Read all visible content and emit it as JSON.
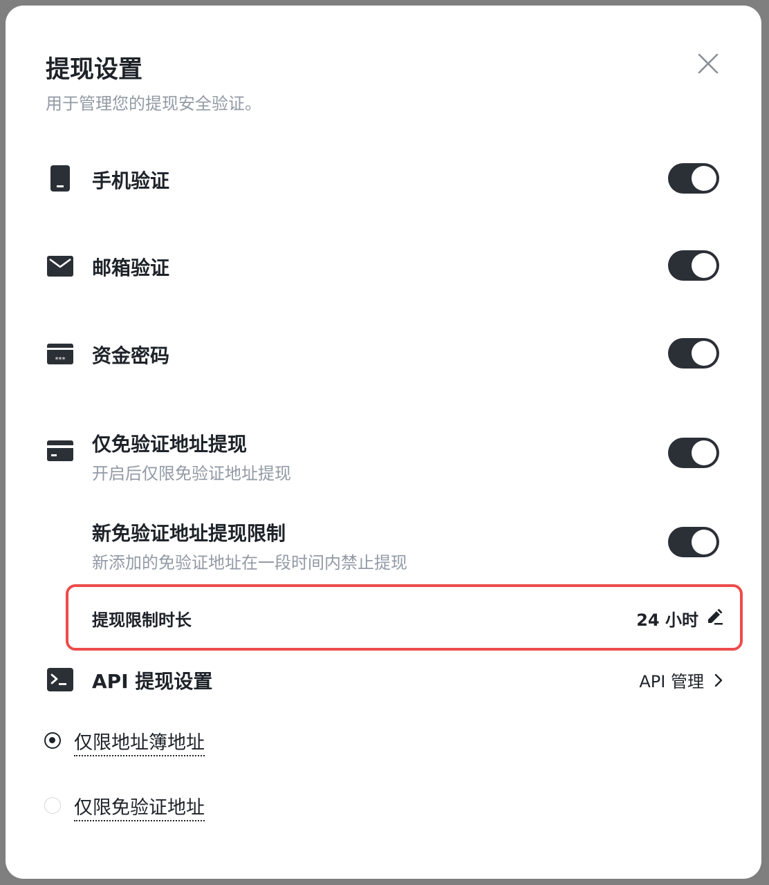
{
  "dialog": {
    "title": "提现设置",
    "subtitle": "用于管理您的提现安全验证。"
  },
  "settings": [
    {
      "label": "手机验证",
      "icon": "phone-icon",
      "enabled": true
    },
    {
      "label": "邮箱验证",
      "icon": "mail-icon",
      "enabled": true
    },
    {
      "label": "资金密码",
      "icon": "password-card-icon",
      "enabled": true
    },
    {
      "label": "仅免验证地址提现",
      "description": "开启后仅限免验证地址提现",
      "icon": "card-icon",
      "enabled": true
    },
    {
      "label": "新免验证地址提现限制",
      "description": "新添加的免验证地址在一段时间内禁止提现",
      "enabled": true
    }
  ],
  "limit": {
    "label": "提现限制时长",
    "value": "24 小时"
  },
  "api": {
    "label": "API 提现设置",
    "link": "API 管理",
    "icon": "terminal-icon"
  },
  "radio_options": [
    {
      "label": "仅限地址簿地址",
      "selected": true
    },
    {
      "label": "仅限免验证地址",
      "selected": false
    }
  ],
  "colors": {
    "toggle_on": "#2b2f36",
    "highlight_border": "#ee4b4b",
    "text_primary": "#1e2329",
    "text_secondary": "#929aa5"
  }
}
